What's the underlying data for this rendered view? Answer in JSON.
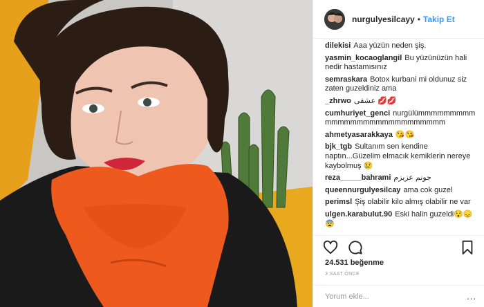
{
  "post": {
    "username": "nurgulyesilcayy",
    "separator": "•",
    "follow_label": "Takip Et",
    "likes": "24.531 beğenme",
    "time_ago": "3 SAAT ÖNCE",
    "add_comment_placeholder": "Yorum ekle...",
    "more_label": "..."
  },
  "comments": [
    {
      "user": "dilekisi",
      "text": "Aaa yüzün neden şiş."
    },
    {
      "user": "yasmin_kocaoglangil",
      "text": "Bu yüzünüzün hali nedir hastamısınız"
    },
    {
      "user": "semraskara",
      "text": "Botox kurbani mi oldunuz siz zaten guzeldiniz ama"
    },
    {
      "user": "_zhrwo",
      "text": "عشقی 💋💋"
    },
    {
      "user": "cumhuriyet_genci",
      "text": "nurgülümmmmmmmmm mmmmmmmmmmmmmmmmmmm"
    },
    {
      "user": "ahmetyasarakkaya",
      "text": "😘😘"
    },
    {
      "user": "bjk_tgb",
      "text": "Sultanım sen kendine naptın...Güzelim elmacık kemiklerin nereye kaybolmuş 😢"
    },
    {
      "user": "reza_____bahrami",
      "text": "جونم عزیزم"
    },
    {
      "user": "queennurgulyesilcay",
      "text": "ama cok guzel"
    },
    {
      "user": "perimsl",
      "text": "Şiş olabilir kilo almış olabilir ne var"
    },
    {
      "user": "ulgen.karabulut.90",
      "text": "Eski halin guzeldi😯😞 😨"
    }
  ],
  "icons": {
    "like": "heart-icon",
    "comment": "comment-bubble-icon",
    "save": "bookmark-icon"
  },
  "colors": {
    "link_blue": "#3897f0",
    "scarf_orange": "#ee5a1e",
    "sofa_yellow": "#e8a21a"
  }
}
